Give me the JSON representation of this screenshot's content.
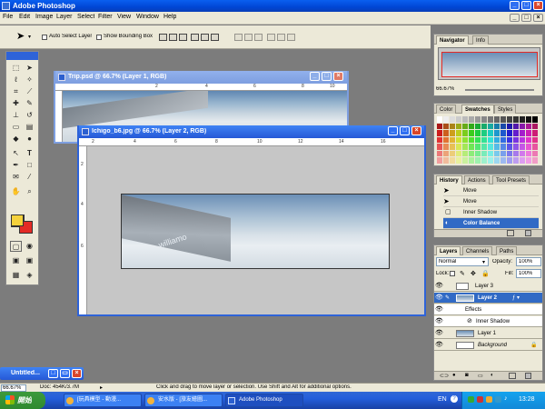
{
  "app": {
    "title": "Adobe Photoshop"
  },
  "menu": [
    "File",
    "Edit",
    "Image",
    "Layer",
    "Select",
    "Filter",
    "View",
    "Window",
    "Help"
  ],
  "options": {
    "auto_select": "Auto Select Layer",
    "show_bbox": "Show Bounding Box"
  },
  "navigator": {
    "tabs": [
      "Navigator",
      "Info"
    ],
    "zoom": "66.67%"
  },
  "swatches": {
    "tabs": [
      "Color",
      "Swatches",
      "Styles"
    ]
  },
  "history": {
    "tabs": [
      "History",
      "Actions",
      "Tool Presets"
    ],
    "items": [
      "Move",
      "Move",
      "Inner Shadow",
      "Color Balance"
    ]
  },
  "layers": {
    "tabs": [
      "Layers",
      "Channels",
      "Paths"
    ],
    "blend_mode": "Normal",
    "opacity_label": "Opacity:",
    "opacity": "100%",
    "lock_label": "Lock:",
    "fill_label": "Fill:",
    "fill": "100%",
    "rows": [
      "Layer 3",
      "Layer 2",
      "Effects",
      "Inner Shadow",
      "Layer 1",
      "Background"
    ]
  },
  "docs": {
    "trip": {
      "title": "Trip.psd @ 66.7% (Layer 1, RGB)"
    },
    "ichigo": {
      "title": "Ichigo_b6.jpg @ 66.7% (Layer 2, RGB)",
      "photo_text": "williamo"
    },
    "untitled": {
      "title": "Untitled..."
    }
  },
  "ruler_ticks": [
    "2",
    "4",
    "6",
    "8",
    "10",
    "12",
    "14",
    "16"
  ],
  "ruler_ticks_trip": [
    "2",
    "4",
    "6",
    "8",
    "10"
  ],
  "vruler_ticks": [
    "2",
    "4",
    "6"
  ],
  "status": {
    "zoom": "66.67%",
    "doc": "Doc: 454K/3.7M",
    "hint": "Click and drag to move layer or selection. Use Shift and Alt for additional options."
  },
  "taskbar": {
    "start": "開始",
    "buttons": [
      "[玩具模型 - 動漫...",
      "安水版 - [旅友繪圖...",
      "Adobe Photoshop"
    ],
    "lang": "EN",
    "clock": "13:28"
  },
  "colors": {
    "fg": "#f5d23c",
    "bg": "#e42a25"
  }
}
